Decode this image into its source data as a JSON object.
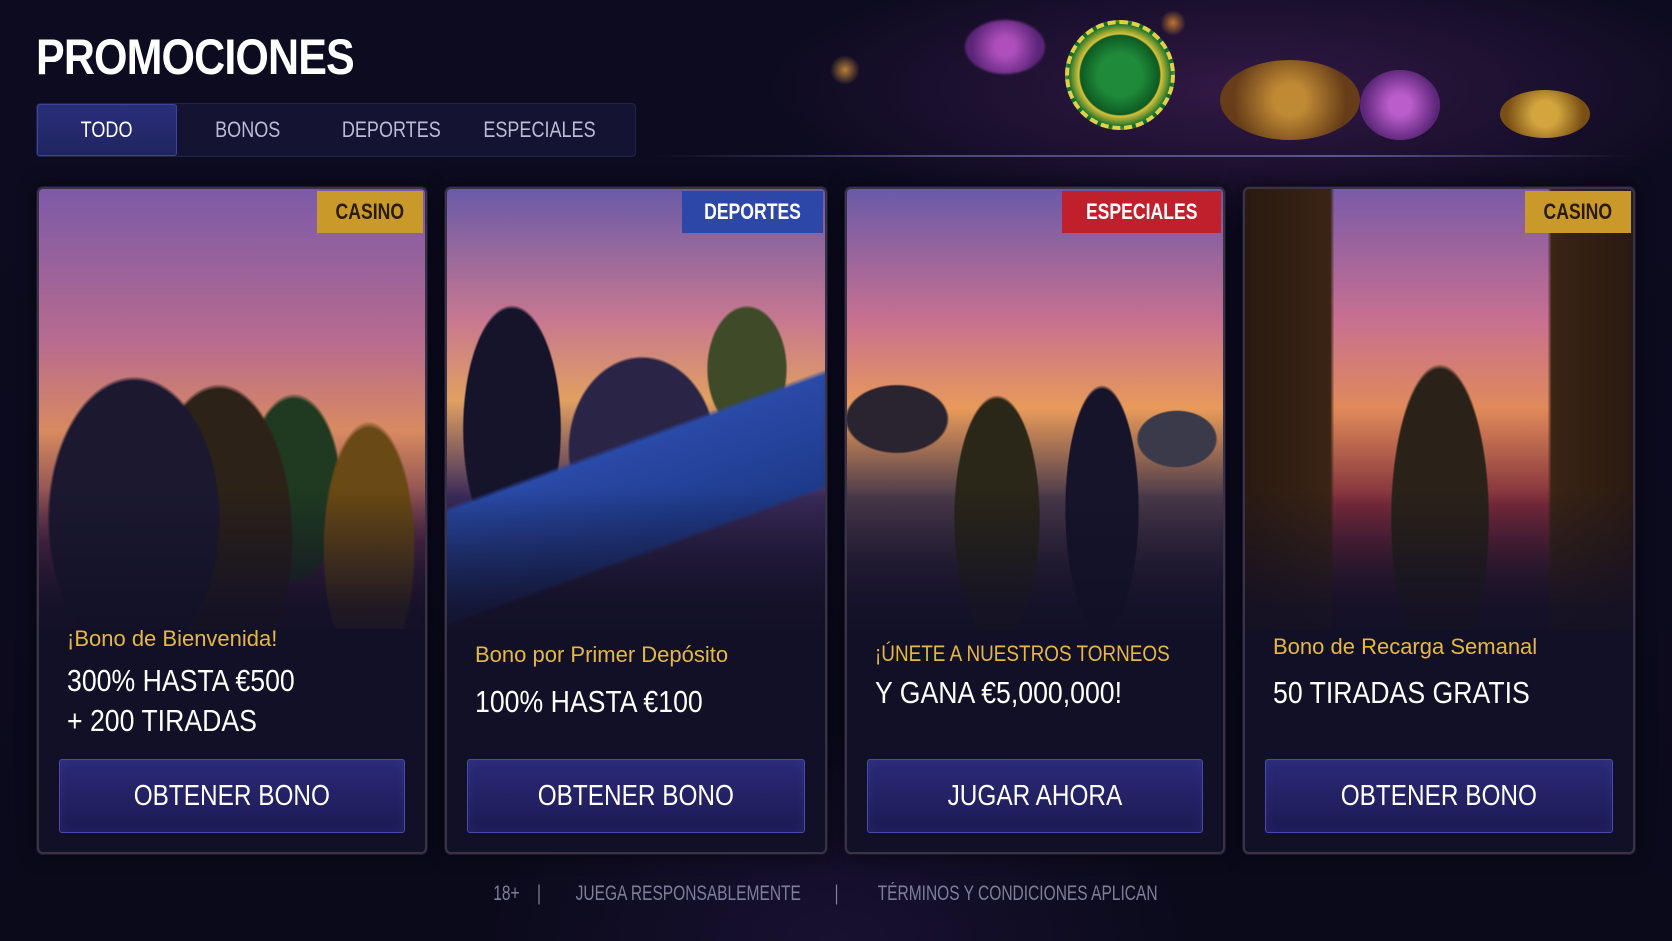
{
  "header": {
    "title": "PROMOCIONES"
  },
  "tabs": [
    {
      "label": "TODO",
      "active": true
    },
    {
      "label": "BONOS",
      "active": false
    },
    {
      "label": "DEPORTES",
      "active": false
    },
    {
      "label": "ESPECIALES",
      "active": false
    }
  ],
  "cards": [
    {
      "badge": "CASINO",
      "subtitle": "¡Bono de Bienvenida!",
      "offer_line1": "300% HASTA €500",
      "offer_line2": "+ 200 TIRADAS",
      "button": "OBTENER BONO"
    },
    {
      "badge": "DEPORTES",
      "subtitle": "Bono por Primer Depósito",
      "offer_line1": "100% HASTA €100",
      "offer_line2": "",
      "button": "OBTENER BONO"
    },
    {
      "badge": "ESPECIALES",
      "subtitle": "¡ÚNETE A NUESTROS TORNEOS",
      "offer_line1": "Y GANA €5,000,000!",
      "offer_line2": "",
      "button": "JUGAR AHORA"
    },
    {
      "badge": "CASINO",
      "subtitle": "Bono de Recarga Semanal",
      "offer_line1": "50 TIRADAS GRATIS",
      "offer_line2": "",
      "button": "OBTENER BONO"
    }
  ],
  "footer": {
    "age": "18+",
    "separator": "|",
    "responsible": "JUEGA RESPONSABLEMENTE",
    "terms": "TÉRMINOS Y CONDICIONES APLICAN"
  },
  "colors": {
    "background": "#0c0b1d",
    "accent_gold": "#e6b744",
    "tab_active": "#2a2f7a",
    "button": "#2b2a78",
    "badge_casino": "#c99a2a",
    "badge_deportes": "#2c47a8",
    "badge_especiales": "#c0202c"
  }
}
